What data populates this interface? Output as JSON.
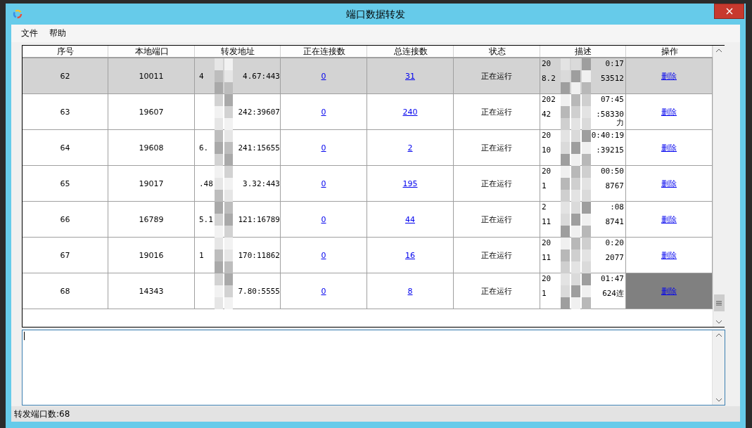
{
  "window": {
    "title": "端口数据转发"
  },
  "menu": [
    "文件",
    "帮助"
  ],
  "table": {
    "columns": [
      "序号",
      "本地端口",
      "转发地址",
      "正在连接数",
      "总连接数",
      "状态",
      "描述",
      "操作"
    ],
    "rows": [
      {
        "index": "62",
        "local_port": "10011",
        "address_start": "4",
        "address_end": "4.67:443",
        "active": "0",
        "total": "31",
        "status": "正在运行",
        "desc_lines": [
          {
            "start": "20",
            "end": "0:17"
          },
          {
            "start": "8.2",
            "end": "53512"
          }
        ],
        "action": "删除",
        "selected": true,
        "action_focused": false
      },
      {
        "index": "63",
        "local_port": "19607",
        "address_end": "242:39607",
        "active": "0",
        "total": "240",
        "status": "正在运行",
        "desc_lines": [
          {
            "start": "202",
            "end": "07:45"
          },
          {
            "start": "42",
            "end": ":58330"
          },
          {
            "end": "力"
          }
        ],
        "action": "删除",
        "selected": false,
        "action_focused": false
      },
      {
        "index": "64",
        "local_port": "19608",
        "address_start": "6.",
        "address_end": "241:15655",
        "active": "0",
        "total": "2",
        "status": "正在运行",
        "desc_lines": [
          {
            "start": "20",
            "end": "0:40:19"
          },
          {
            "start": "10",
            "end": ":39215"
          }
        ],
        "action": "删除",
        "selected": false,
        "action_focused": false
      },
      {
        "index": "65",
        "local_port": "19017",
        "address_start": ".48",
        "address_end": "3.32:443",
        "active": "0",
        "total": "195",
        "status": "正在运行",
        "desc_lines": [
          {
            "start": "20",
            "end": "00:50"
          },
          {
            "start": "1",
            "end": "8767"
          }
        ],
        "action": "删除",
        "selected": false,
        "action_focused": false
      },
      {
        "index": "66",
        "local_port": "16789",
        "address_start": "5.1",
        "address_end": "121:16789",
        "active": "0",
        "total": "44",
        "status": "正在运行",
        "desc_lines": [
          {
            "start": "2",
            "end": ":08"
          },
          {
            "start": "11",
            "end": "8741"
          }
        ],
        "action": "删除",
        "selected": false,
        "action_focused": false
      },
      {
        "index": "67",
        "local_port": "19016",
        "address_start": "1",
        "address_end": "170:11862",
        "active": "0",
        "total": "16",
        "status": "正在运行",
        "desc_lines": [
          {
            "start": "20",
            "end": "0:20"
          },
          {
            "start": "11",
            "end": "2077"
          }
        ],
        "action": "删除",
        "selected": false,
        "action_focused": false
      },
      {
        "index": "68",
        "local_port": "14343",
        "address_end": "7.80:5555",
        "active": "0",
        "total": "8",
        "status": "正在运行",
        "desc_lines": [
          {
            "start": "20",
            "end": "01:47"
          },
          {
            "start": "1",
            "end": "624连"
          }
        ],
        "action": "删除",
        "selected": false,
        "action_focused": true
      }
    ]
  },
  "status_bar": "转发端口数:68"
}
